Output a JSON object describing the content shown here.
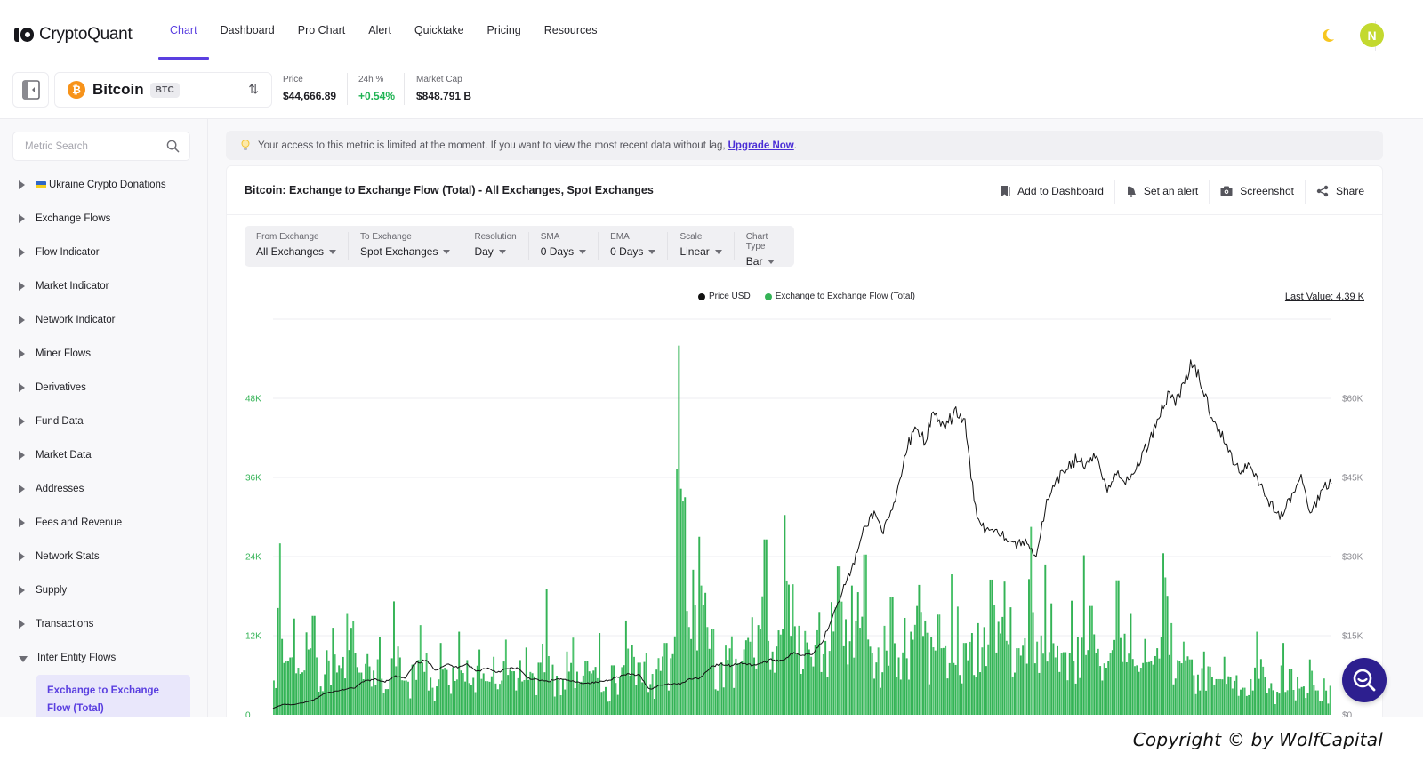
{
  "brand": {
    "name": "CryptoQuant"
  },
  "nav": {
    "items": [
      {
        "label": "Chart",
        "active": true
      },
      {
        "label": "Dashboard"
      },
      {
        "label": "Pro Chart"
      },
      {
        "label": "Alert"
      },
      {
        "label": "Quicktake"
      },
      {
        "label": "Pricing"
      },
      {
        "label": "Resources"
      }
    ],
    "theme_icon": "moon-icon",
    "avatar_initial": "N",
    "avatar_color": "#c3d92f"
  },
  "asset": {
    "name": "Bitcoin",
    "symbol": "BTC",
    "icon_glyph": "₿",
    "price_label": "Price",
    "price_value": "$44,666.89",
    "change_label": "24h %",
    "change_value": "+0.54%",
    "marketcap_label": "Market Cap",
    "marketcap_value": "$848.791 B"
  },
  "sidebar": {
    "search_placeholder": "Metric Search",
    "items": [
      {
        "label": "Ukraine Crypto Donations",
        "flag": true,
        "expanded": false
      },
      {
        "label": "Exchange Flows",
        "expanded": false
      },
      {
        "label": "Flow Indicator",
        "expanded": false
      },
      {
        "label": "Market Indicator",
        "expanded": false
      },
      {
        "label": "Network Indicator",
        "expanded": false
      },
      {
        "label": "Miner Flows",
        "expanded": false
      },
      {
        "label": "Derivatives",
        "expanded": false
      },
      {
        "label": "Fund Data",
        "expanded": false
      },
      {
        "label": "Market Data",
        "expanded": false
      },
      {
        "label": "Addresses",
        "expanded": false
      },
      {
        "label": "Fees and Revenue",
        "expanded": false
      },
      {
        "label": "Network Stats",
        "expanded": false
      },
      {
        "label": "Supply",
        "expanded": false
      },
      {
        "label": "Transactions",
        "expanded": false
      },
      {
        "label": "Inter Entity Flows",
        "expanded": true
      }
    ],
    "active_subitem": "Exchange to Exchange Flow (Total)"
  },
  "notice": {
    "text": "Your access to this metric is limited at the moment. If you want to view the most recent data without lag,",
    "link": "Upgrade Now",
    "trailing": "."
  },
  "card": {
    "title": "Bitcoin: Exchange to Exchange Flow (Total) - All Exchanges, Spot Exchanges",
    "actions": [
      {
        "label": "Add to Dashboard",
        "icon": "bookmark-icon"
      },
      {
        "label": "Set an alert",
        "icon": "bell-icon"
      },
      {
        "label": "Screenshot",
        "icon": "camera-icon"
      },
      {
        "label": "Share",
        "icon": "share-icon"
      }
    ],
    "filters": [
      {
        "label": "From Exchange",
        "value": "All Exchanges"
      },
      {
        "label": "To Exchange",
        "value": "Spot Exchanges"
      },
      {
        "label": "Resolution",
        "value": "Day"
      },
      {
        "label": "SMA",
        "value": "0 Days"
      },
      {
        "label": "EMA",
        "value": "0 Days"
      },
      {
        "label": "Scale",
        "value": "Linear"
      },
      {
        "label": "Chart Type",
        "value": "Bar"
      }
    ],
    "last_value": "Last Value: 4.39 K"
  },
  "footer": {
    "copyright": "Copyright © by WolfCapital"
  },
  "chart_data": {
    "type": "bar",
    "title": "Bitcoin: Exchange to Exchange Flow (Total) - All Exchanges, Spot Exchanges",
    "legend": [
      {
        "name": "Price USD",
        "color": "#111111"
      },
      {
        "name": "Exchange to Exchange Flow (Total)",
        "color": "#34b356"
      }
    ],
    "legend_position": "top-center",
    "grid": true,
    "left_axis": {
      "ticks": [
        "0",
        "12K",
        "24K",
        "36K",
        "48K"
      ],
      "tick_values": [
        0,
        12000,
        24000,
        36000,
        48000
      ],
      "range": [
        0,
        60000
      ],
      "color": "#34b356"
    },
    "right_axis": {
      "ticks": [
        "$0",
        "$15K",
        "$30K",
        "$45K",
        "$60K"
      ],
      "tick_values": [
        0,
        15000,
        30000,
        45000,
        60000
      ],
      "range": [
        0,
        75000
      ],
      "color": "#8a8a90"
    },
    "series": [
      {
        "name": "Exchange to Exchange Flow (Total)",
        "type": "bar",
        "axis": "left",
        "color": "#34b356",
        "values": [
          5200,
          26000,
          8100,
          14600,
          6200,
          12500,
          15000,
          4300,
          9800,
          13200,
          7100,
          15300,
          14200,
          6400,
          9200,
          6700,
          11800,
          3900,
          17200,
          8700,
          5200,
          7600,
          13600,
          9400,
          4100,
          10900,
          6800,
          7200,
          12600,
          8300,
          5600,
          9900,
          5100,
          8800,
          4700,
          11400,
          6600,
          8300,
          10200,
          6300,
          7900,
          19100,
          7600,
          5300,
          9600,
          11700,
          4800,
          8200,
          6700,
          12400,
          4200,
          7500,
          5800,
          14300,
          10600,
          7900,
          9400,
          6200,
          8600,
          10900,
          9200,
          56000,
          33000,
          22000,
          27000,
          18500,
          13000,
          7700,
          10500,
          11900,
          7800,
          11300,
          14800,
          13600,
          26600,
          9600,
          12800,
          30300,
          19800,
          13500,
          12700,
          8800,
          15600,
          11200,
          17100,
          22500,
          14500,
          19600,
          18600,
          24300,
          9300,
          10200,
          13500,
          17900,
          8700,
          14700,
          12600,
          19700,
          14300,
          11800,
          15200,
          10400,
          21300,
          16400,
          10900,
          12400,
          13900,
          13300,
          20500,
          14100,
          20200,
          16300,
          10100,
          11600,
          28500,
          11100,
          22800,
          16900,
          10400,
          9500,
          17300,
          11800,
          24200,
          16500,
          10000,
          7800,
          9400,
          20400,
          12300,
          15300,
          7500,
          11500,
          8200,
          10100,
          24500,
          13900,
          8300,
          11100,
          8400,
          6100,
          9600,
          7300,
          5400,
          8800,
          5700,
          6000,
          4100,
          5400,
          12600,
          7300,
          4800,
          3500,
          10900,
          7000,
          5800,
          4300,
          8400,
          3700,
          5500,
          4390
        ],
        "last_value": 4390
      },
      {
        "name": "Price USD",
        "type": "line",
        "axis": "right",
        "color": "#111111",
        "values": [
          1200,
          2000,
          1900,
          2300,
          2800,
          4000,
          4400,
          4800,
          5100,
          6400,
          6700,
          6300,
          7300,
          6900,
          9800,
          10300,
          8500,
          9600,
          9000,
          9700,
          8200,
          8900,
          8100,
          8700,
          8900,
          7000,
          6600,
          6300,
          6800,
          6500,
          6100,
          6000,
          6200,
          6600,
          7300,
          7700,
          7500,
          4800,
          5600,
          5900,
          5900,
          6800,
          7000,
          9100,
          9600,
          9300,
          9900,
          9400,
          9800,
          10400,
          10300,
          11600,
          11400,
          11700,
          13900,
          18900,
          23800,
          28300,
          34600,
          38400,
          34900,
          39200,
          47900,
          55000,
          52000,
          57500,
          53500,
          58000,
          55000,
          39000,
          35000,
          35500,
          33600,
          32300,
          32800,
          30200,
          40000,
          44000,
          47000,
          48500,
          47000,
          49300,
          42500,
          46000,
          44000,
          47500,
          51500,
          56600,
          60800,
          59800,
          66000,
          64000,
          58000,
          54000,
          49500,
          46300,
          47800,
          43700,
          40000,
          37500,
          41000,
          45000,
          38000,
          42500,
          44700
        ]
      }
    ]
  }
}
